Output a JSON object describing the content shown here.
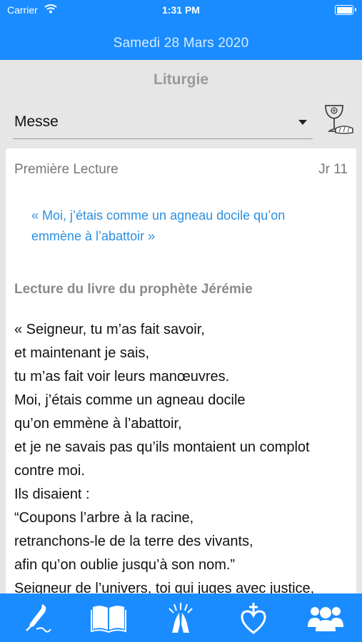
{
  "status_bar": {
    "carrier": "Carrier",
    "time": "1:31 PM",
    "battery_level": 1.0
  },
  "header": {
    "date": "Samedi 28 Mars 2020"
  },
  "liturgy": {
    "section_title": "Liturgie",
    "select_value": "Messe",
    "chalice_icon": "chalice-icon"
  },
  "reading": {
    "heading": "Première Lecture",
    "reference": "Jr 11",
    "quote_lines": [
      "« Moi, j’étais comme un agneau docile qu’on",
      "emmène à l’abattoir »"
    ],
    "title": "Lecture du livre du prophète Jérémie",
    "lines": [
      "« Seigneur, tu m’as fait savoir,",
      "et maintenant je sais,",
      "tu m’as fait voir leurs manœuvres.",
      "Moi, j’étais comme un agneau docile",
      "qu’on emmène à l’abattoir,",
      "et je ne savais pas qu’ils montaient un complot",
      "contre moi.",
      "Ils disaient :",
      "“Coupons l’arbre à la racine,",
      "retranchons-le de la terre des vivants,",
      "afin qu’on oublie jusqu’à son nom.”",
      "Seigneur de l’univers, toi qui juges avec justice,"
    ]
  },
  "tabs": [
    {
      "icon": "quill-icon"
    },
    {
      "icon": "book-icon"
    },
    {
      "icon": "praying-hands-icon"
    },
    {
      "icon": "heart-cross-icon"
    },
    {
      "icon": "people-group-icon"
    }
  ],
  "colors": {
    "accent": "#1a8cff",
    "background": "#e6e6e6",
    "quote": "#2b8fe0"
  }
}
